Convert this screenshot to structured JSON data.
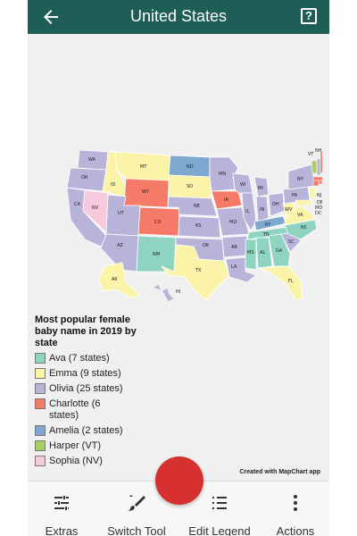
{
  "header": {
    "title": "United States"
  },
  "legend": {
    "title": "Most popular female baby name in 2019 by state",
    "items": [
      {
        "label": "Ava (7 states)",
        "color": "#8fd3c1"
      },
      {
        "label": "Emma (9 states)",
        "color": "#fbf3a8"
      },
      {
        "label": "Olivia (25 states)",
        "color": "#b7b3d9"
      },
      {
        "label": "Charlotte (6 states)",
        "color": "#f57a68"
      },
      {
        "label": "Amelia (2 states)",
        "color": "#7ea8d0"
      },
      {
        "label": "Harper (VT)",
        "color": "#a6cf63"
      },
      {
        "label": "Sophia (NV)",
        "color": "#f7c9dd"
      }
    ]
  },
  "credit": "Created with MapChart app",
  "bottom_bar": {
    "extras": "Extras",
    "switch_tool": "Switch Tool",
    "edit_legend": "Edit Legend",
    "actions": "Actions"
  },
  "map_states": [
    "WA",
    "OR",
    "CA",
    "NV",
    "ID",
    "MT",
    "WY",
    "UT",
    "AZ",
    "CO",
    "NM",
    "ND",
    "SD",
    "NE",
    "KS",
    "OK",
    "TX",
    "MN",
    "IA",
    "MO",
    "AR",
    "LA",
    "WI",
    "IL",
    "MI",
    "IN",
    "OH",
    "KY",
    "TN",
    "MS",
    "AL",
    "GA",
    "FL",
    "SC",
    "NC",
    "VA",
    "WV",
    "PA",
    "NY",
    "ME",
    "VT",
    "NH",
    "MA",
    "CT",
    "RI",
    "NJ",
    "DE",
    "MD",
    "DC",
    "AK",
    "HI"
  ]
}
